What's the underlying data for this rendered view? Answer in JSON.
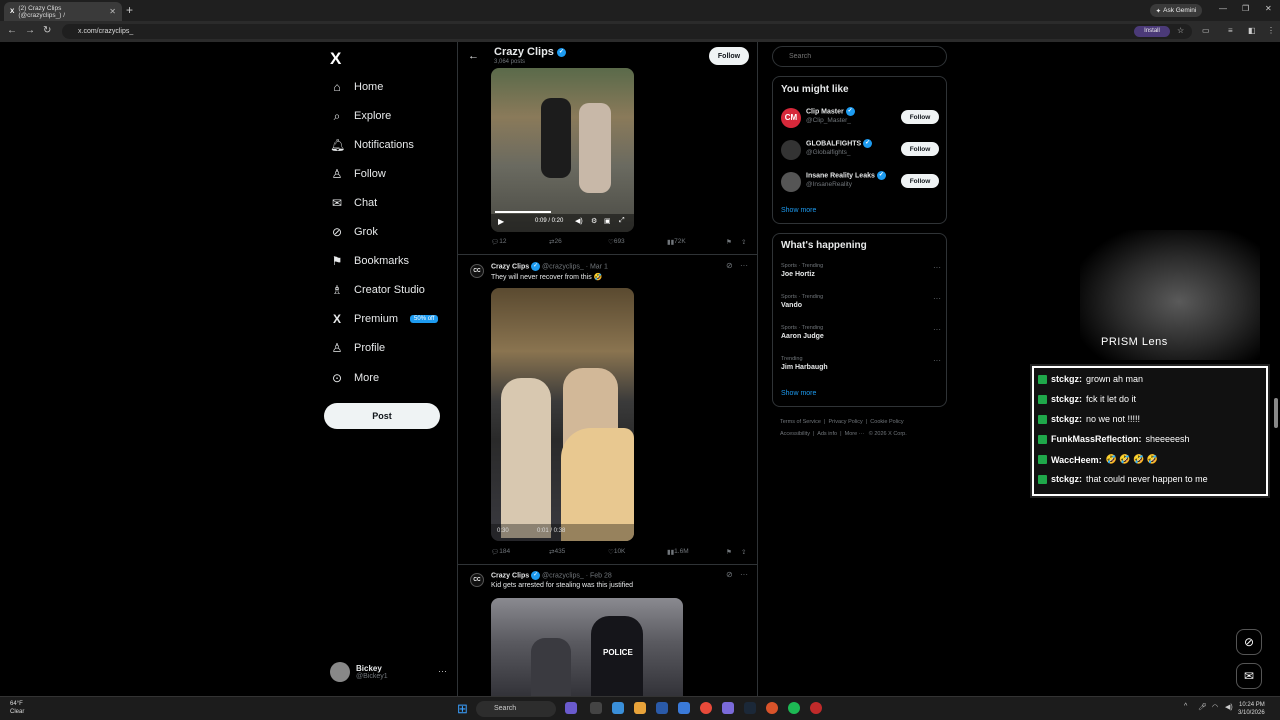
{
  "browser": {
    "tab_title": "(2) Crazy Clips (@crazyclips_) /",
    "tab_close": "✕",
    "new_tab": "+",
    "ask_gemini": "Ask Gemini",
    "url": "x.com/crazyclips_",
    "install": "Install"
  },
  "sidebar": {
    "items": [
      {
        "label": "Home",
        "icon": "⌂"
      },
      {
        "label": "Explore",
        "icon": "⌕"
      },
      {
        "label": "Notifications",
        "icon": "♫"
      },
      {
        "label": "Follow",
        "icon": "♙"
      },
      {
        "label": "Chat",
        "icon": "✉"
      },
      {
        "label": "Grok",
        "icon": "⊘"
      },
      {
        "label": "Bookmarks",
        "icon": "⚑"
      },
      {
        "label": "Creator Studio",
        "icon": "♗"
      },
      {
        "label": "Premium",
        "icon": "X"
      },
      {
        "label": "Profile",
        "icon": "♙"
      },
      {
        "label": "More",
        "icon": "⊙"
      }
    ],
    "premium_badge": "50% off",
    "post_label": "Post",
    "account": {
      "name": "Bickey",
      "handle": "@Bickey1"
    }
  },
  "profile_header": {
    "name": "Crazy Clips",
    "posts": "3,064 posts",
    "follow": "Follow"
  },
  "tweets": [
    {
      "video_time": "0:09 / 0:20",
      "replies": "12",
      "reposts": "26",
      "likes": "693",
      "views": "72K"
    },
    {
      "name": "Crazy Clips",
      "handle": "@crazyclips_ · Mar 1",
      "text": "They will never recover from this 🤣",
      "video_time": "0:01 / 0:38",
      "video_remaining": "0:30",
      "replies": "184",
      "reposts": "435",
      "likes": "10K",
      "views": "1.6M"
    },
    {
      "name": "Crazy Clips",
      "handle": "@crazyclips_ · Feb 28",
      "text": "Kid gets arrested for stealing was this justified",
      "police_text": "POLICE"
    }
  ],
  "right": {
    "search_placeholder": "Search",
    "you_might_like": "You might like",
    "suggestions": [
      {
        "name": "Clip Master",
        "handle": "@Clip_Master_",
        "follow": "Follow",
        "color": "#d6283a"
      },
      {
        "name": "GLOBALFIGHTS",
        "handle": "@Globalfights_",
        "follow": "Follow",
        "color": "#333333"
      },
      {
        "name": "Insane Reality Leaks",
        "handle": "@InsaneReality",
        "follow": "Follow",
        "color": "#555555"
      }
    ],
    "show_more": "Show more",
    "whats_happening": "What's happening",
    "trends": [
      {
        "category": "Sports · Trending",
        "name": "Joe Hortiz"
      },
      {
        "category": "Sports · Trending",
        "name": "Vando"
      },
      {
        "category": "Sports · Trending",
        "name": "Aaron Judge"
      },
      {
        "category": "Trending",
        "name": "Jim Harbaugh"
      }
    ],
    "show_more_2": "Show more",
    "footer": [
      "Terms of Service",
      "Privacy Policy",
      "Cookie Policy",
      "Accessibility",
      "Ads info",
      "More ···",
      "© 2026 X Corp."
    ]
  },
  "overlay": {
    "prism": "PRISM Lens",
    "chat": [
      {
        "user": "stckgz:",
        "msg": "grown ah man"
      },
      {
        "user": "stckgz:",
        "msg": "fck it let do it"
      },
      {
        "user": "stckgz:",
        "msg": "no we not !!!!!"
      },
      {
        "user": "FunkMassReflection:",
        "msg": "sheeeeesh"
      },
      {
        "user": "WaccHeem:",
        "msg": "🤣 🤣 🤣 🤣"
      },
      {
        "user": "stckgz:",
        "msg": "that could never happen to me"
      }
    ]
  },
  "taskbar": {
    "weather_temp": "64°F",
    "weather_cond": "Clear",
    "search": "Search",
    "time": "10:24 PM",
    "date": "3/10/2026"
  },
  "colors": {
    "accent": "#1d9bf0",
    "background": "#000000",
    "border": "#2f3336"
  }
}
